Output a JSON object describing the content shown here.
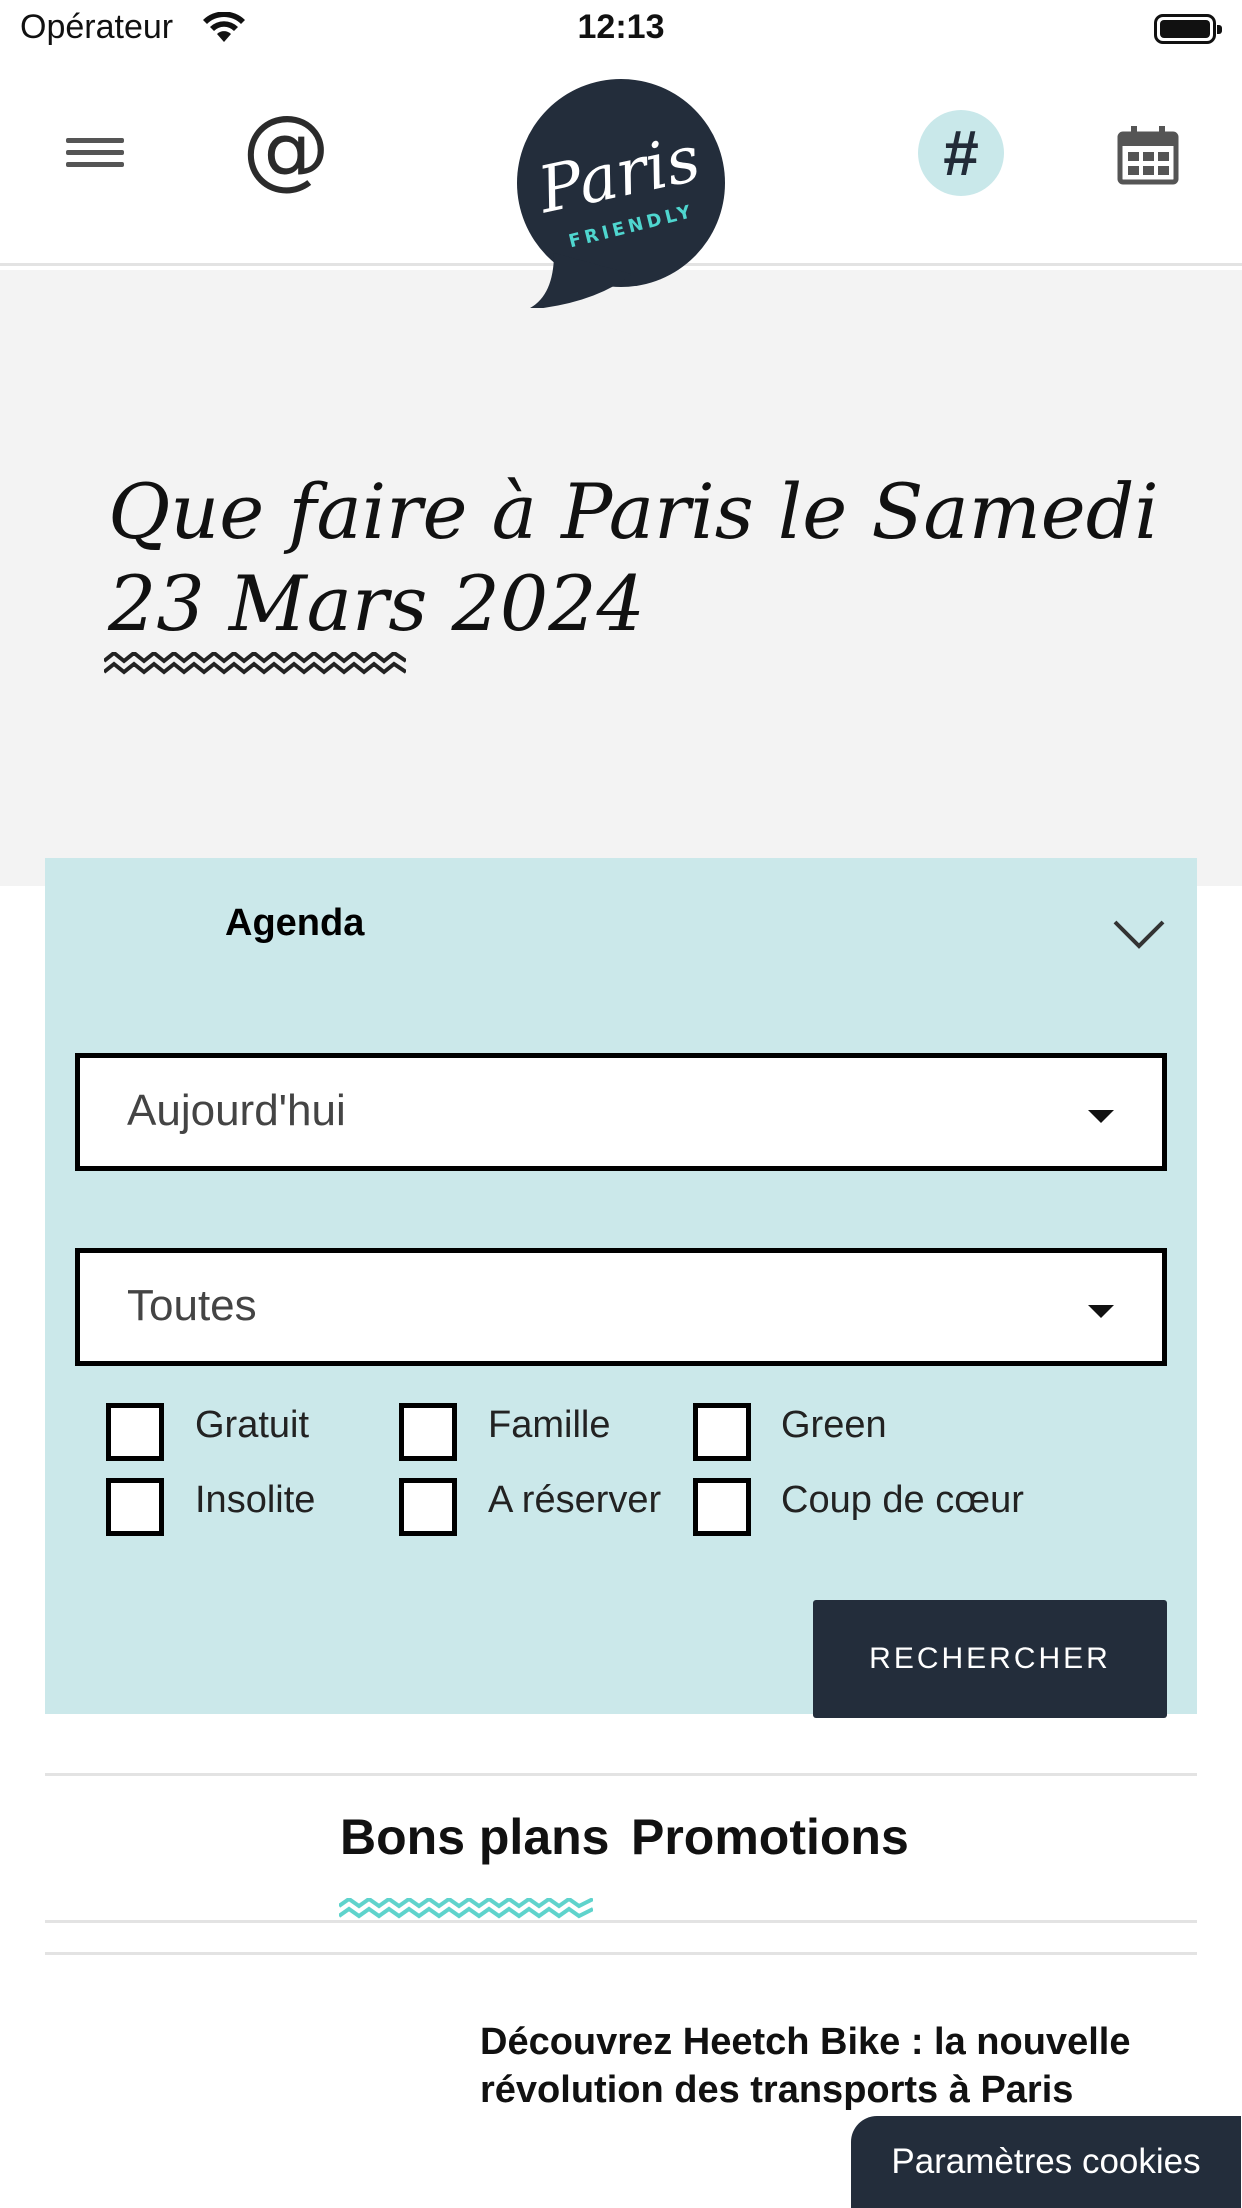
{
  "status_bar": {
    "carrier": "Opérateur",
    "time": "12:13"
  },
  "header": {
    "menu_icon": "hamburger-icon",
    "at_symbol": "@",
    "hash_symbol": "#",
    "calendar_icon": "calendar-icon",
    "logo": {
      "name": "Paris",
      "tagline": "FRIENDLY"
    }
  },
  "hero": {
    "title_line1": "Que faire à Paris le Samedi",
    "title_line2": "23 Mars 2024"
  },
  "agenda": {
    "title": "Agenda",
    "date_select": "Aujourd'hui",
    "category_select": "Toutes",
    "filters": [
      "Gratuit",
      "Famille",
      "Green",
      "Insolite",
      "A réserver",
      "Coup de cœur"
    ],
    "search_button": "RECHERCHER"
  },
  "tabs": [
    "Bons plans",
    "Promotions"
  ],
  "article": {
    "title": "Découvrez Heetch Bike : la nouvelle révolution des transports à Paris"
  },
  "cookie_button": "Paramètres cookies",
  "colors": {
    "navy": "#232d3b",
    "panel": "#cbe8ea",
    "accent_teal": "#5fd3cc",
    "hero_bg": "#f3f3f3"
  }
}
